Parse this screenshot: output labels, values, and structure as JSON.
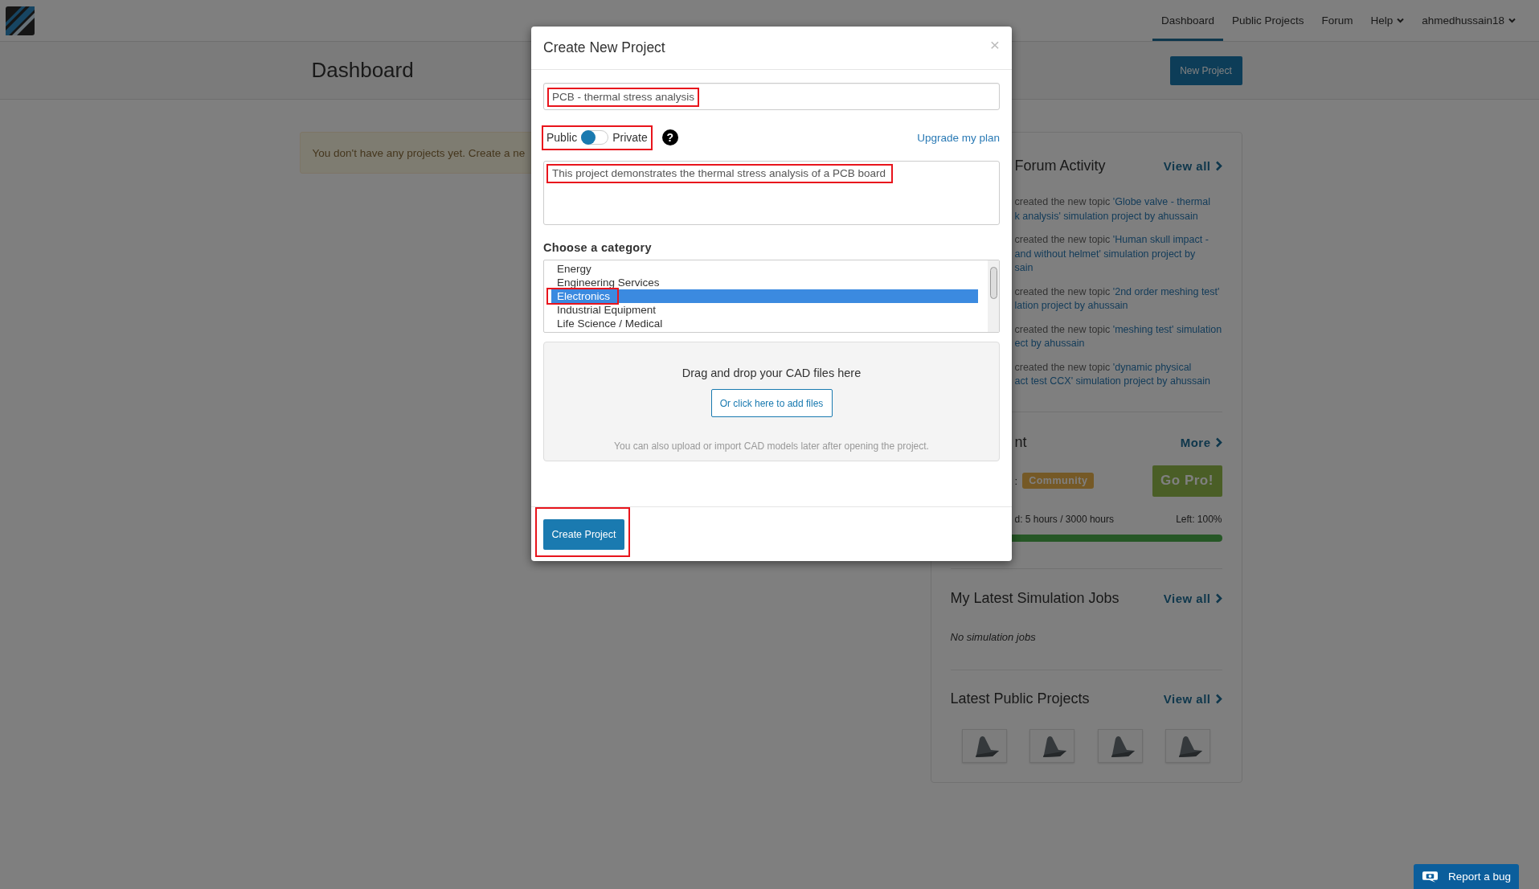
{
  "nav": {
    "items": [
      {
        "label": "Dashboard",
        "selected": true,
        "dropdown": false
      },
      {
        "label": "Public Projects",
        "selected": false,
        "dropdown": false
      },
      {
        "label": "Forum",
        "selected": false,
        "dropdown": false
      },
      {
        "label": "Help",
        "selected": false,
        "dropdown": true
      },
      {
        "label": "ahmedhussain18",
        "selected": false,
        "dropdown": true
      }
    ]
  },
  "header": {
    "title": "Dashboard",
    "button": "New Project"
  },
  "alert": {
    "text": "You don't have any projects yet. Create a ne"
  },
  "side_panel": {
    "forum": {
      "title": "Forum Activity",
      "link": "View all",
      "items": [
        {
          "lines": [
            {
              "text": "created the new topic ",
              "link": "'Globe valve - thermal"
            },
            {
              "link": "k analysis' simulation project by ahussain"
            }
          ]
        },
        {
          "lines": [
            {
              "text": "created the new topic ",
              "link": "'Human skull impact -"
            },
            {
              "link": "and without helmet' simulation project by"
            },
            {
              "link": "sain"
            }
          ]
        },
        {
          "lines": [
            {
              "text": "created the new topic ",
              "link": "'2nd order meshing test'"
            },
            {
              "link": "lation project by ahussain"
            }
          ]
        },
        {
          "lines": [
            {
              "text": "created the new topic ",
              "link": "'meshing test' simulation"
            },
            {
              "link": "ect by ahussain"
            }
          ]
        },
        {
          "lines": [
            {
              "text": "created the new topic ",
              "link": "'dynamic physical"
            },
            {
              "link": "act test CCX' simulation project by ahussain"
            }
          ]
        }
      ]
    },
    "plan": {
      "title": "nt",
      "link": "More",
      "label": ":",
      "badge": "Community",
      "button": "Go Pro!",
      "usage": "d: 5 hours / 3000 hours",
      "left": "Left: 100%",
      "level": 1
    },
    "jobs": {
      "title": "My Latest Simulation Jobs",
      "link": "View all",
      "empty": "No simulation jobs"
    },
    "projects": {
      "title": "Latest Public Projects",
      "link": "View all",
      "thumbnails": [
        {
          "kind": "model"
        },
        {
          "kind": "model"
        },
        {
          "kind": "model"
        },
        {
          "kind": "model"
        }
      ]
    }
  },
  "modal": {
    "title": "Create New Project",
    "close": "×",
    "name_field": {
      "value": "PCB - thermal stress analysis",
      "highlighted": true
    },
    "visibility": {
      "left": "Public",
      "right": "Private",
      "private": false,
      "highlighted": true,
      "help": "?"
    },
    "upgrade": "Upgrade my plan",
    "description": {
      "value": "This project demonstrates the thermal stress analysis of a PCB board",
      "highlighted": true
    },
    "category_label": "Choose a category",
    "categories": [
      {
        "label": "Energy",
        "selected": false,
        "highlighted": false
      },
      {
        "label": "Engineering Services",
        "selected": false,
        "highlighted": false
      },
      {
        "label": "Electronics",
        "selected": true,
        "highlighted": true
      },
      {
        "label": "Industrial Equipment",
        "selected": false,
        "highlighted": false
      },
      {
        "label": "Life Science / Medical",
        "selected": false,
        "highlighted": false
      }
    ],
    "dropzone": {
      "title": "Drag and drop your CAD files here",
      "button": "Or click here to add files",
      "hint": "You can also upload or import CAD models later after opening the project."
    },
    "submit": {
      "label": "Create Project",
      "highlighted": true
    }
  },
  "report": {
    "label": "Report a bug"
  }
}
